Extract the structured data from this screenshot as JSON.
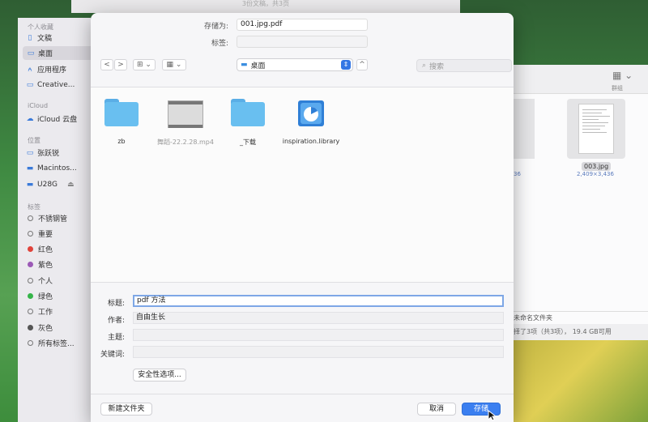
{
  "background_window": {
    "top_text": "3份文稿，共3页",
    "group_label": "群组",
    "file_name": "003.jpg",
    "file_size": "2,409×3,436",
    "left_file_size": "36",
    "path_text": "未命名文件夹",
    "status_text": "择了3项（共3项）， 19.4 GB可用"
  },
  "sidebar": {
    "sections": {
      "favorites": "个人收藏",
      "icloud": "iCloud",
      "locations": "位置",
      "tags": "标签"
    },
    "favorites": [
      {
        "label": "文稿",
        "icon": "document-icon"
      },
      {
        "label": "桌面",
        "icon": "desktop-icon",
        "selected": true
      },
      {
        "label": "应用程序",
        "icon": "applications-icon"
      },
      {
        "label": "Creative...",
        "icon": "folder-icon"
      }
    ],
    "icloud": [
      {
        "label": "iCloud 云盘",
        "icon": "cloud-icon"
      }
    ],
    "locations": [
      {
        "label": "张跃锐",
        "icon": "computer-icon"
      },
      {
        "label": "Macintos...",
        "icon": "disk-icon"
      },
      {
        "label": "U28G",
        "icon": "drive-icon",
        "eject": "⏏"
      }
    ],
    "tags": [
      {
        "label": "不锈钢管",
        "color": "none"
      },
      {
        "label": "重要",
        "color": "none"
      },
      {
        "label": "红色",
        "color": "#e0433b"
      },
      {
        "label": "紫色",
        "color": "#9b59b6"
      },
      {
        "label": "个人",
        "color": "none"
      },
      {
        "label": "绿色",
        "color": "#35b449"
      },
      {
        "label": "工作",
        "color": "none"
      },
      {
        "label": "灰色",
        "color": "#555555"
      },
      {
        "label": "所有标签...",
        "color": "multi"
      }
    ]
  },
  "dialog": {
    "save_as_label": "存储为:",
    "save_as_value": "001.jpg.pdf",
    "tags_label": "标签:",
    "toolbar": {
      "back": "<",
      "forward": ">",
      "icon_view": "⊞ ⌄",
      "group_view": "▦ ⌄",
      "location": "桌面",
      "location_arrows": "⇕",
      "expand": "^"
    },
    "search_placeholder": "搜索",
    "files": [
      {
        "name": "zb",
        "kind": "folder"
      },
      {
        "name": "舞蹈-22.2.28.mp4",
        "kind": "video"
      },
      {
        "name": "_下载",
        "kind": "folder"
      },
      {
        "name": "inspiration.library",
        "kind": "library"
      }
    ],
    "form": {
      "title_label": "标题:",
      "title_value": "pdf 方法",
      "author_label": "作者:",
      "author_value": "自由生长",
      "subject_label": "主题:",
      "subject_value": "",
      "keywords_label": "关键词:",
      "keywords_value": "",
      "security_button": "安全性选项..."
    },
    "buttons": {
      "new_folder": "新建文件夹",
      "cancel": "取消",
      "save": "存储"
    }
  }
}
